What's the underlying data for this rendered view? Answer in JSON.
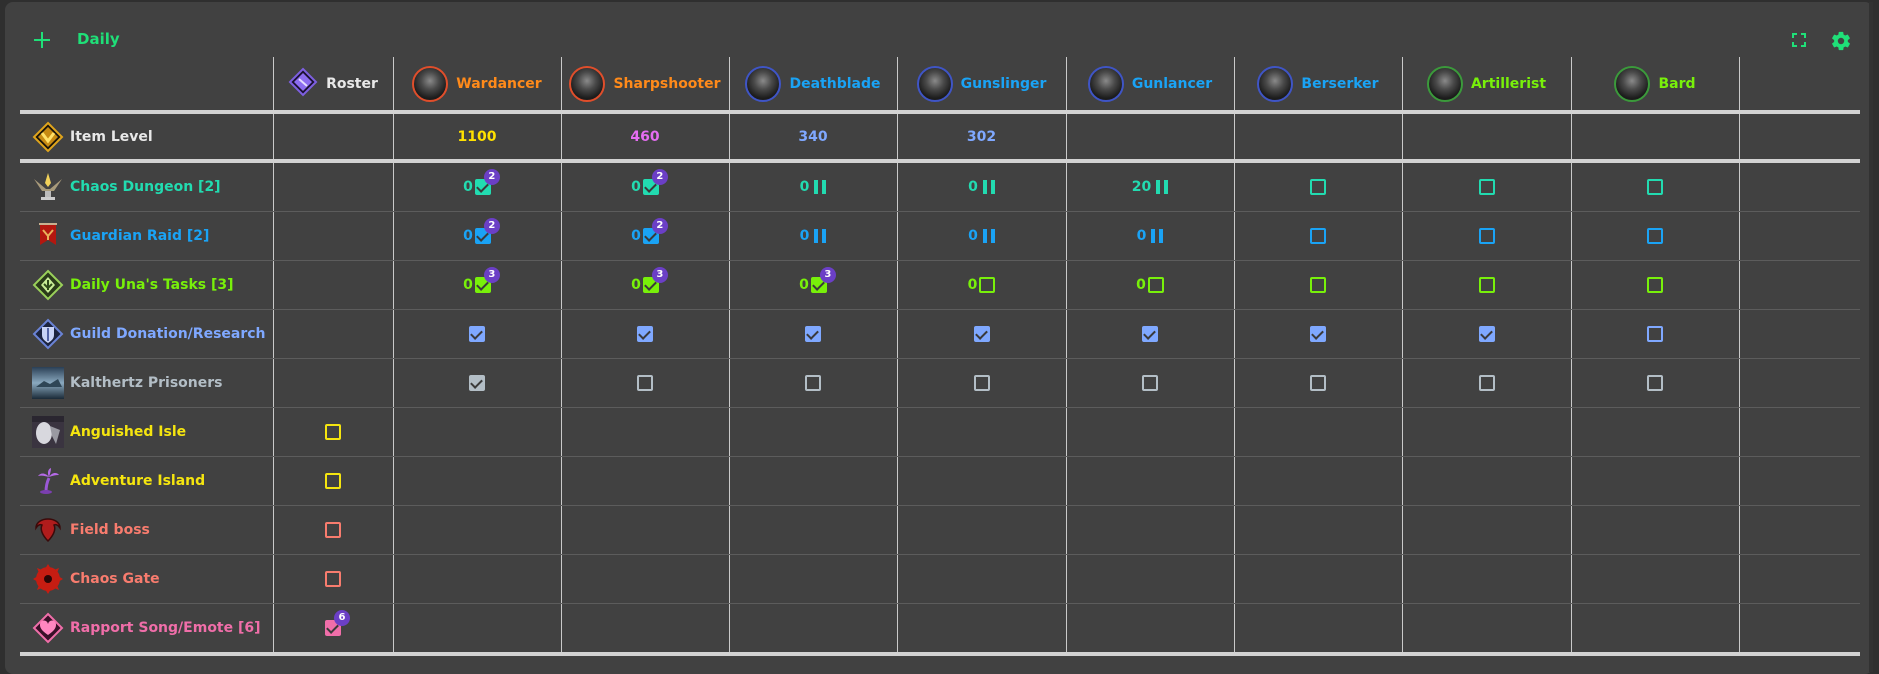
{
  "header": {
    "title": "Daily",
    "add_icon": "plus-icon",
    "fullscreen_icon": "fullscreen-icon",
    "settings_icon": "gear-icon"
  },
  "colors": {
    "accent": "#1fdf78",
    "chaos": "#22dbb0",
    "guardian": "#1aa3f5",
    "una": "#78f00a",
    "guild": "#7fa8ff",
    "kalthertz": "#b3bec6",
    "isle": "#f5e50f",
    "fieldboss": "#f87c6e",
    "rapport": "#f06ea9",
    "badge": "#6b3fc6"
  },
  "roster_header": {
    "label": "Roster",
    "icon": "roster-diamond-icon",
    "color": "#e8e8e8"
  },
  "characters": [
    {
      "name": "Wardancer",
      "color": "#ff8a1a",
      "ring": "#e04e2b",
      "item_level": "1100",
      "ilvl_color": "#ffe100"
    },
    {
      "name": "Sharpshooter",
      "color": "#ff8a1a",
      "ring": "#e04e2b",
      "item_level": "460",
      "ilvl_color": "#e66df2"
    },
    {
      "name": "Deathblade",
      "color": "#1aa3f5",
      "ring": "#3f55c6",
      "item_level": "340",
      "ilvl_color": "#7fa8ff"
    },
    {
      "name": "Gunslinger",
      "color": "#1aa3f5",
      "ring": "#3f55c6",
      "item_level": "302",
      "ilvl_color": "#7fa8ff"
    },
    {
      "name": "Gunlancer",
      "color": "#1aa3f5",
      "ring": "#3f55c6",
      "item_level": "",
      "ilvl_color": "#7fa8ff"
    },
    {
      "name": "Berserker",
      "color": "#1aa3f5",
      "ring": "#3f55c6",
      "item_level": "",
      "ilvl_color": "#7fa8ff"
    },
    {
      "name": "Artillerist",
      "color": "#78f00a",
      "ring": "#3b9a3b",
      "item_level": "",
      "ilvl_color": "#7fa8ff"
    },
    {
      "name": "Bard",
      "color": "#78f00a",
      "ring": "#3b9a3b",
      "item_level": "",
      "ilvl_color": "#7fa8ff"
    }
  ],
  "item_level_row": {
    "label": "Item Level",
    "icon": "item-level-icon",
    "color": "#e8e8e8"
  },
  "tasks": [
    {
      "label": "Chaos Dungeon [2]",
      "icon": "chaos-dungeon-icon",
      "color": "#22dbb0",
      "scope": "character",
      "cells": [
        {
          "count": "0",
          "state": "checked",
          "badge": "2"
        },
        {
          "count": "0",
          "state": "checked",
          "badge": "2"
        },
        {
          "count": "0",
          "state": "paused"
        },
        {
          "count": "0",
          "state": "paused"
        },
        {
          "count": "20",
          "state": "paused"
        },
        {
          "state": "unchecked"
        },
        {
          "state": "unchecked"
        },
        {
          "state": "unchecked"
        }
      ]
    },
    {
      "label": "Guardian Raid [2]",
      "icon": "guardian-raid-icon",
      "color": "#1aa3f5",
      "scope": "character",
      "cells": [
        {
          "count": "0",
          "state": "checked",
          "badge": "2"
        },
        {
          "count": "0",
          "state": "checked",
          "badge": "2"
        },
        {
          "count": "0",
          "state": "paused"
        },
        {
          "count": "0",
          "state": "paused"
        },
        {
          "count": "0",
          "state": "paused"
        },
        {
          "state": "unchecked"
        },
        {
          "state": "unchecked"
        },
        {
          "state": "unchecked"
        }
      ]
    },
    {
      "label": "Daily Una's Tasks [3]",
      "icon": "una-tasks-icon",
      "color": "#78f00a",
      "scope": "character",
      "cells": [
        {
          "count": "0",
          "state": "checked",
          "badge": "3"
        },
        {
          "count": "0",
          "state": "checked",
          "badge": "3"
        },
        {
          "count": "0",
          "state": "checked",
          "badge": "3"
        },
        {
          "count": "0",
          "state": "unchecked"
        },
        {
          "count": "0",
          "state": "unchecked"
        },
        {
          "state": "unchecked"
        },
        {
          "state": "unchecked"
        },
        {
          "state": "unchecked"
        }
      ]
    },
    {
      "label": "Guild Donation/Research",
      "icon": "guild-shield-icon",
      "color": "#7fa8ff",
      "scope": "character",
      "cells": [
        {
          "state": "checked"
        },
        {
          "state": "checked"
        },
        {
          "state": "checked"
        },
        {
          "state": "checked"
        },
        {
          "state": "checked"
        },
        {
          "state": "checked"
        },
        {
          "state": "checked"
        },
        {
          "state": "unchecked"
        }
      ]
    },
    {
      "label": "Kalthertz Prisoners",
      "icon": "kalthertz-icon",
      "color": "#b3bec6",
      "scope": "character",
      "cells": [
        {
          "state": "checked"
        },
        {
          "state": "unchecked"
        },
        {
          "state": "unchecked"
        },
        {
          "state": "unchecked"
        },
        {
          "state": "unchecked"
        },
        {
          "state": "unchecked"
        },
        {
          "state": "unchecked"
        },
        {
          "state": "unchecked"
        }
      ]
    },
    {
      "label": "Anguished Isle",
      "icon": "anguished-isle-icon",
      "color": "#f5e50f",
      "scope": "roster",
      "roster_cell": {
        "state": "unchecked"
      }
    },
    {
      "label": "Adventure Island",
      "icon": "palm-tree-icon",
      "color": "#f5e50f",
      "scope": "roster",
      "roster_cell": {
        "state": "unchecked"
      }
    },
    {
      "label": "Field boss",
      "icon": "field-boss-icon",
      "color": "#f87c6e",
      "scope": "roster",
      "roster_cell": {
        "state": "unchecked"
      }
    },
    {
      "label": "Chaos Gate",
      "icon": "chaos-gate-icon",
      "color": "#f87c6e",
      "scope": "roster",
      "roster_cell": {
        "state": "unchecked"
      }
    },
    {
      "label": "Rapport Song/Emote [6]",
      "icon": "rapport-heart-icon",
      "color": "#f06ea9",
      "scope": "roster",
      "roster_cell": {
        "state": "checked",
        "badge": "6"
      }
    }
  ]
}
